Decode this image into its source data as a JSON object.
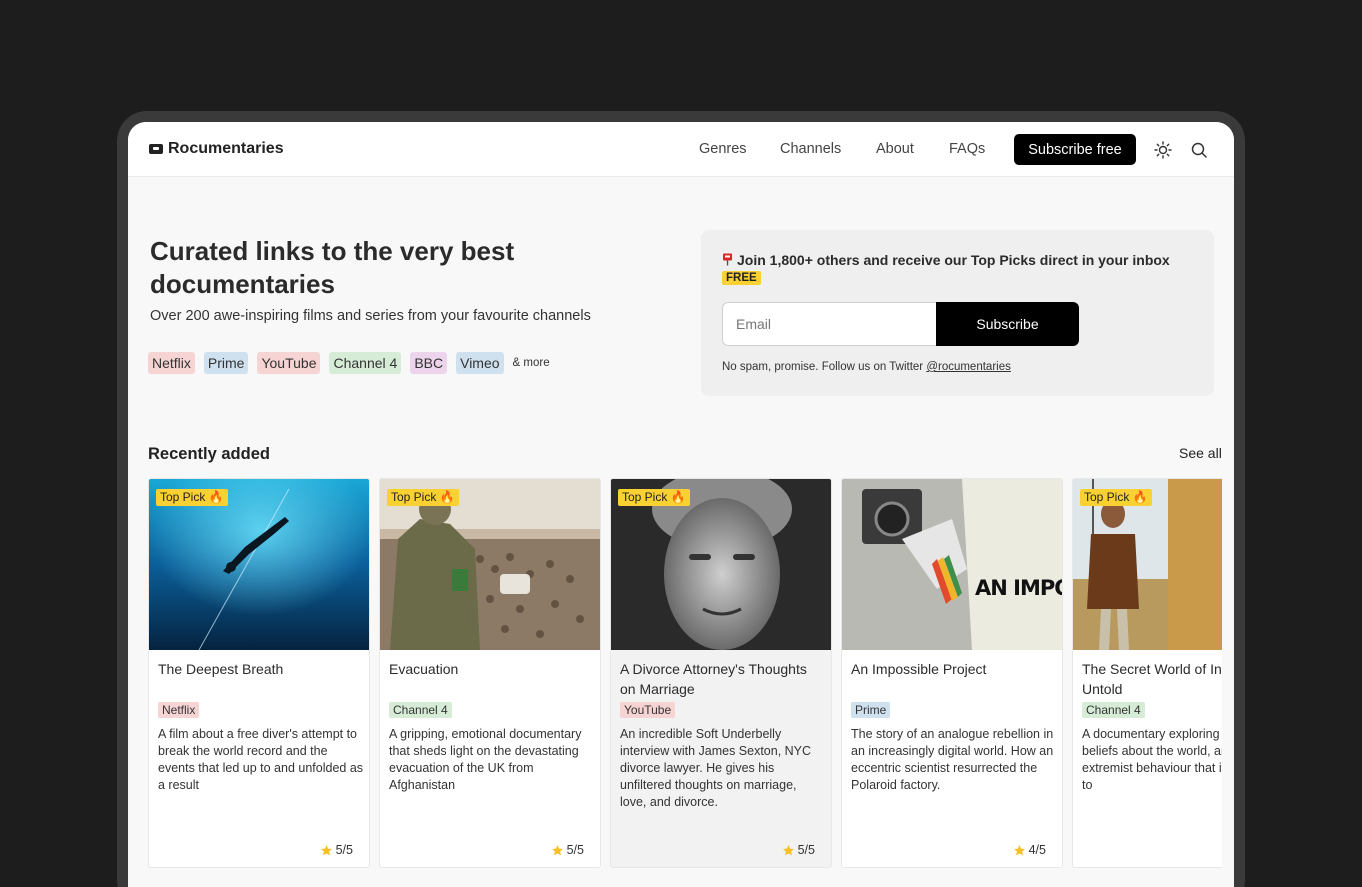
{
  "nav": {
    "brand": "Rocumentaries",
    "links": [
      "Genres",
      "Channels",
      "About",
      "FAQs"
    ],
    "cta": "Subscribe free"
  },
  "hero": {
    "title": "Curated links to the very best documentaries",
    "subtitle": "Over 200 awe-inspiring films and series from your favourite channels",
    "chips": [
      {
        "label": "Netflix",
        "color": "#f7d4d4"
      },
      {
        "label": "Prime",
        "color": "#cfe0ef"
      },
      {
        "label": "YouTube",
        "color": "#f7d4d4"
      },
      {
        "label": "Channel 4",
        "color": "#d6ecd6"
      },
      {
        "label": "BBC",
        "color": "#ecd5ec"
      },
      {
        "label": "Vimeo",
        "color": "#cfe0ef"
      }
    ],
    "more": "& more"
  },
  "signup": {
    "heading": "Join 1,800+ others and receive our Top Picks direct in your inbox",
    "badge": "FREE",
    "placeholder": "Email",
    "button": "Subscribe",
    "note_prefix": "No spam, promise. Follow us on Twitter ",
    "note_link": "@rocumentaries"
  },
  "recent": {
    "title": "Recently added",
    "see_all": "See all",
    "top_pick_label": "Top Pick 🔥",
    "cards": [
      {
        "title": "The Deepest Breath",
        "channel": "Netflix",
        "channel_color": "#f7d4d4",
        "description": "A film about a free diver's attempt to break the world record and the events that led up to and unfolded as a result",
        "rating": "5/5",
        "top_pick": true
      },
      {
        "title": "Evacuation",
        "channel": "Channel 4",
        "channel_color": "#d6ecd6",
        "description": "A gripping, emotional documentary that sheds light on the devastating evacuation of the UK from Afghanistan",
        "rating": "5/5",
        "top_pick": true
      },
      {
        "title": "A Divorce Attorney's Thoughts on Marriage",
        "channel": "YouTube",
        "channel_color": "#f7d4d4",
        "description": "An incredible Soft Underbelly interview with James Sexton, NYC divorce lawyer. He gives his unfiltered thoughts on marriage, love, and divorce.",
        "rating": "5/5",
        "top_pick": true
      },
      {
        "title": "An Impossible Project",
        "channel": "Prime",
        "channel_color": "#cfe0ef",
        "description": "The story of an analogue rebellion in an increasingly digital world. How an eccentric scientist resurrected the Polaroid factory.",
        "rating": "4/5",
        "top_pick": false,
        "poster_text": "AN IMPOSSIBLE PROJECT"
      },
      {
        "title": "The Secret World of Incels Untold",
        "channel": "Channel 4",
        "channel_color": "#d6ecd6",
        "description": "A documentary exploring incels, their beliefs about the world, and the extremist behaviour that it can lead to",
        "rating": "",
        "top_pick": true
      }
    ]
  }
}
